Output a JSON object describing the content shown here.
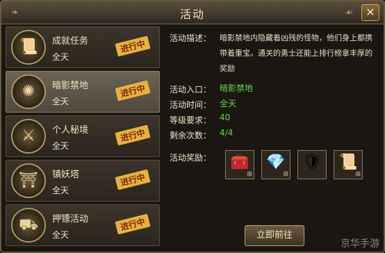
{
  "window": {
    "title": "活动",
    "close_glyph": "✕"
  },
  "activities": [
    {
      "name": "成就任务",
      "time": "全天",
      "status": "进行中",
      "icon": "papers-icon",
      "glyph": "📜",
      "selected": false
    },
    {
      "name": "暗影禁地",
      "time": "全天",
      "status": "进行中",
      "icon": "swirl-icon",
      "glyph": "✺",
      "selected": true
    },
    {
      "name": "个人秘境",
      "time": "全天",
      "status": "进行中",
      "icon": "shield-sword-icon",
      "glyph": "⚔",
      "selected": false
    },
    {
      "name": "镇妖塔",
      "time": "全天",
      "status": "进行中",
      "icon": "pagoda-icon",
      "glyph": "⛩",
      "selected": false
    },
    {
      "name": "押镖活动",
      "time": "全天",
      "status": "进行中",
      "icon": "cart-icon",
      "glyph": "⛟",
      "selected": false
    }
  ],
  "detail": {
    "desc_label": "活动描述：",
    "desc_text": "暗影禁地内隐藏着凶残的怪物，他们身上都携带着重宝。通关的勇士还能上排行榜拿丰厚的奖励",
    "entry_label": "活动入口：",
    "entry_value": "暗影禁地",
    "time_label": "活动时间：",
    "time_value": "全天",
    "level_label": "等级要求：",
    "level_value": "40",
    "remain_label": "剩余次数：",
    "remain_value": "4/4",
    "reward_label": "活动奖励：",
    "rewards": [
      {
        "icon": "treasure-chest-icon",
        "glyph": "🧰",
        "badge": "⊞"
      },
      {
        "icon": "silver-gem-icon",
        "glyph": "💎",
        "badge": "⊞"
      },
      {
        "icon": "gold-emblem-icon",
        "glyph": "🛡",
        "badge": ""
      },
      {
        "icon": "scroll-icon",
        "glyph": "📜",
        "badge": "⊞"
      }
    ],
    "go_button": "立即前往"
  },
  "watermark": "京华手游"
}
